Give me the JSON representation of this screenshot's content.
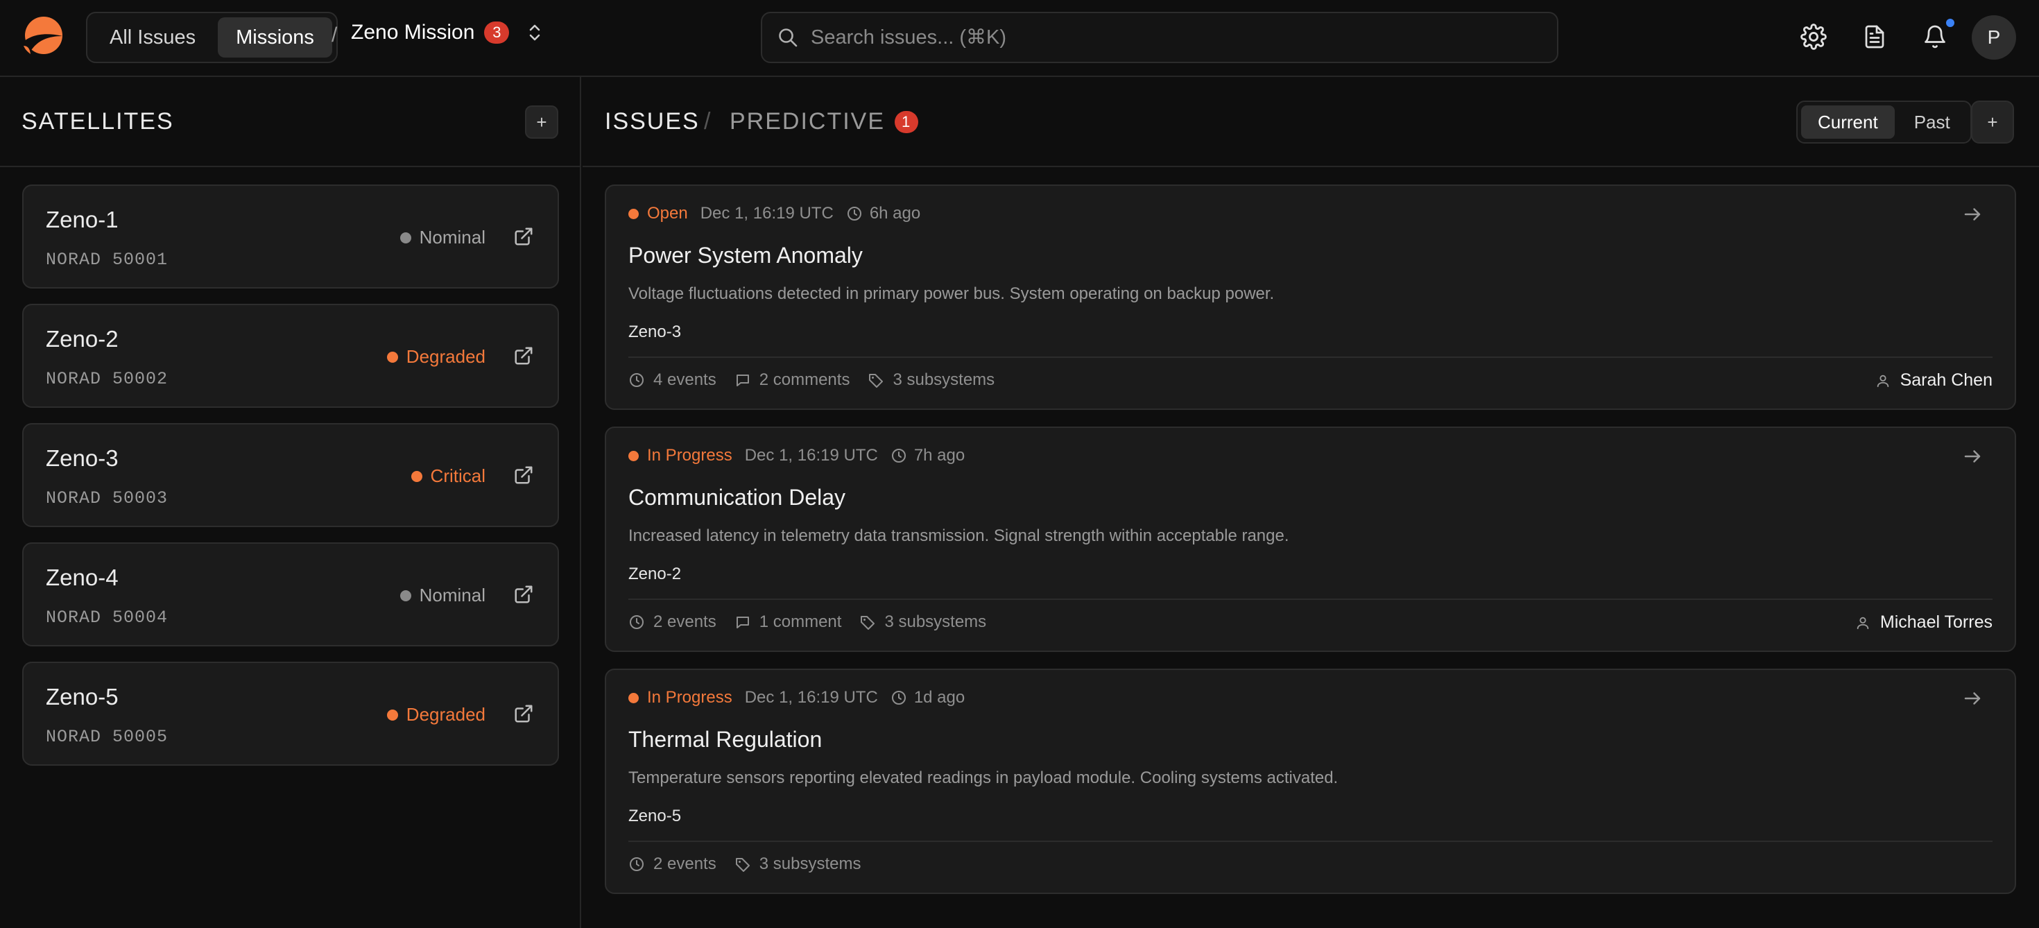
{
  "colors": {
    "accent": "#f4793b",
    "badge": "#d73a2c",
    "nominal": "#8a8a8a",
    "notification": "#3b82f6"
  },
  "nav": {
    "all_issues": "All Issues",
    "missions": "Missions",
    "separator": "/",
    "mission_name": "Zeno Mission",
    "mission_count": "3"
  },
  "search": {
    "placeholder": "Search issues... (⌘K)"
  },
  "header_icons": [
    "settings-icon",
    "document-icon",
    "bell-icon"
  ],
  "user": {
    "avatar_initial": "P"
  },
  "sidebar": {
    "title": "SATELLITES",
    "add_label": "+",
    "satellites": [
      {
        "name": "Zeno-1",
        "norad": "NORAD 50001",
        "status": "Nominal",
        "status_color": "#8a8a8a"
      },
      {
        "name": "Zeno-2",
        "norad": "NORAD 50002",
        "status": "Degraded",
        "status_color": "#f4793b"
      },
      {
        "name": "Zeno-3",
        "norad": "NORAD 50003",
        "status": "Critical",
        "status_color": "#f4793b"
      },
      {
        "name": "Zeno-4",
        "norad": "NORAD 50004",
        "status": "Nominal",
        "status_color": "#8a8a8a"
      },
      {
        "name": "Zeno-5",
        "norad": "NORAD 50005",
        "status": "Degraded",
        "status_color": "#f4793b"
      }
    ]
  },
  "main": {
    "issues_label": "ISSUES",
    "separator": "/",
    "predictive_label": "PREDICTIVE",
    "predictive_count": "1",
    "toggle": {
      "current": "Current",
      "past": "Past"
    },
    "add_label": "+",
    "issues": [
      {
        "state": "Open",
        "date": "Dec 1, 16:19 UTC",
        "ago": "6h ago",
        "title": "Power System Anomaly",
        "description": "Voltage fluctuations detected in primary power bus. System operating on backup power.",
        "satellite": "Zeno-3",
        "events": "4 events",
        "comments": "2 comments",
        "subsystems": "3 subsystems",
        "assignee": "Sarah Chen"
      },
      {
        "state": "In Progress",
        "date": "Dec 1, 16:19 UTC",
        "ago": "7h ago",
        "title": "Communication Delay",
        "description": "Increased latency in telemetry data transmission. Signal strength within acceptable range.",
        "satellite": "Zeno-2",
        "events": "2 events",
        "comments": "1 comment",
        "subsystems": "3 subsystems",
        "assignee": "Michael Torres"
      },
      {
        "state": "In Progress",
        "date": "Dec 1, 16:19 UTC",
        "ago": "1d ago",
        "title": "Thermal Regulation",
        "description": "Temperature sensors reporting elevated readings in payload module. Cooling systems activated.",
        "satellite": "Zeno-5",
        "events": "2 events",
        "subsystems": "3 subsystems"
      }
    ]
  }
}
